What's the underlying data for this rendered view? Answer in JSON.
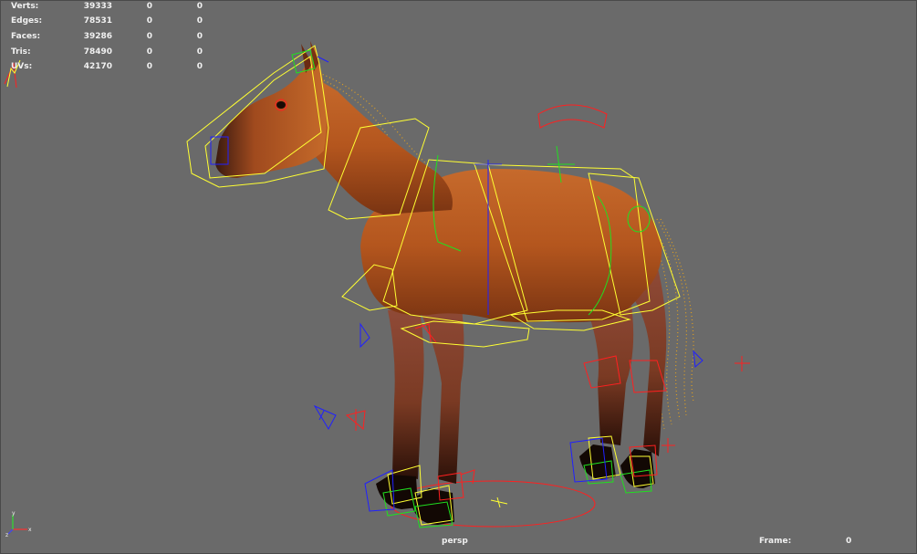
{
  "hud": {
    "rows": [
      {
        "label": "Verts:",
        "value": "39333",
        "c1": "0",
        "c2": "0"
      },
      {
        "label": "Edges:",
        "value": "78531",
        "c1": "0",
        "c2": "0"
      },
      {
        "label": "Faces:",
        "value": "39286",
        "c1": "0",
        "c2": "0"
      },
      {
        "label": "Tris:",
        "value": "78490",
        "c1": "0",
        "c2": "0"
      },
      {
        "label": "UVs:",
        "value": "42170",
        "c1": "0",
        "c2": "0"
      }
    ]
  },
  "viewport": {
    "camera": "persp",
    "frame_label": "Frame:",
    "frame_value": "0",
    "colors": {
      "background": "#6a6a6a",
      "rig_control": "#ffff33",
      "ik_control_red": "#ff2020",
      "ik_control_blue": "#2020ff",
      "ik_control_green": "#20e020",
      "horse_coat": "#b5581f"
    }
  },
  "axis_gizmo": {
    "x": "x",
    "y": "y",
    "z": "z"
  }
}
